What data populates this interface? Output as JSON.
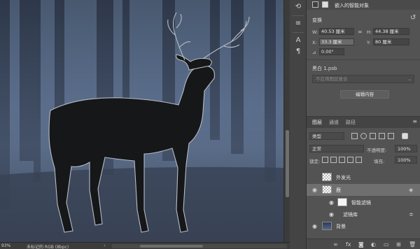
{
  "status": {
    "zoom": "93%",
    "doc_info": "未标记的 RGB (8bpc)"
  },
  "properties": {
    "title": "嵌入的智能对象",
    "transform_label": "变换",
    "w_label": "W:",
    "w_value": "40.53 厘米",
    "h_label": "H:",
    "h_value": "44.38 厘米",
    "x_label": "X:",
    "x_value": "33.3 厘米",
    "y_label": "Y:",
    "y_value": "80 厘米",
    "angle_value": "0.00°",
    "file_name": "黑白 1.psb",
    "comp_dropdown": "不应用图层复合",
    "edit_button": "编辑内容"
  },
  "layers_panel": {
    "tabs": [
      "图层",
      "通道",
      "路径"
    ],
    "filter_kind": "类型",
    "blend_mode": "正常",
    "opacity_label": "不透明度:",
    "opacity_value": "100%",
    "lock_label": "锁定:",
    "fill_label": "填充:",
    "fill_value": "100%",
    "layers": [
      {
        "name": "外发光",
        "visible": false
      },
      {
        "name": "鹿",
        "visible": true,
        "selected": true
      },
      {
        "name": "智能滤镜",
        "visible": true
      },
      {
        "name": "滤镜库",
        "visible": true
      },
      {
        "name": "背景",
        "visible": true
      }
    ],
    "fx_label": "fx"
  },
  "colors": {
    "panel_bg": "#535353",
    "canvas_bg": "#556885",
    "selected_layer": "#6f6f6f"
  }
}
